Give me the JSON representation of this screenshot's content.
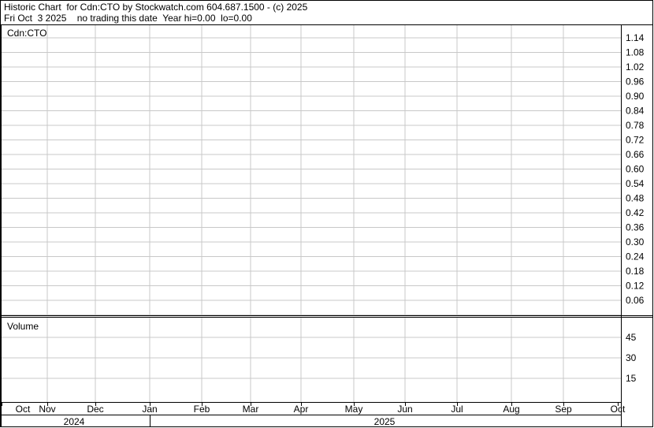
{
  "header": {
    "line1": "Historic Chart  for Cdn:CTO by Stockwatch.com 604.687.1500 - (c) 2025",
    "line2": "Fri Oct  3 2025    no trading this date  Year hi=0.00  lo=0.00"
  },
  "chart_data": {
    "type": "line",
    "symbol_label": "Cdn:CTO",
    "volume_label": "Volume",
    "price_ticks": [
      "1.14",
      "1.08",
      "1.02",
      "0.96",
      "0.90",
      "0.84",
      "0.78",
      "0.72",
      "0.66",
      "0.60",
      "0.54",
      "0.48",
      "0.42",
      "0.36",
      "0.30",
      "0.24",
      "0.18",
      "0.12",
      "0.06"
    ],
    "volume_ticks": [
      "45",
      "30",
      "15"
    ],
    "months": [
      "Oct",
      "Nov",
      "Dec",
      "Jan",
      "Feb",
      "Mar",
      "Apr",
      "May",
      "Jun",
      "Jul",
      "Aug",
      "Sep",
      "Oct"
    ],
    "years": [
      "2024",
      "2025"
    ],
    "series": [],
    "grid": true,
    "colors": {
      "background": "#ffffff",
      "grid": "#c8c8c8",
      "frame": "#000000"
    }
  }
}
